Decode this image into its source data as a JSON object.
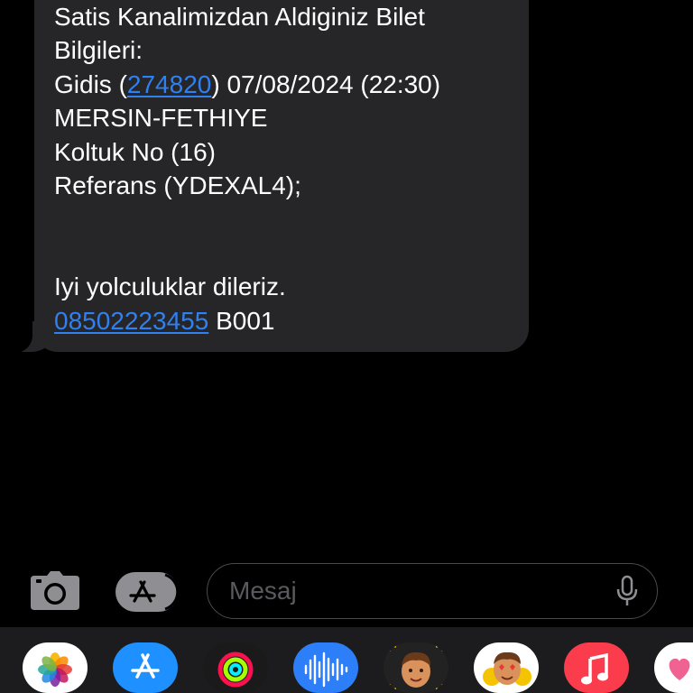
{
  "message": {
    "lines": [
      "Satis Kanalimizdan Aldiginiz Bilet",
      "Bilgileri:",
      "Gidis (",
      "274820",
      ") 07/08/2024 (22:30)",
      "MERSIN-FETHIYE",
      "Koltuk No (16)",
      "Referans (YDEXAL4);",
      "Iyi yolculuklar dileriz.",
      "08502223455",
      " B001"
    ]
  },
  "input": {
    "placeholder": "Mesaj"
  },
  "icons": {
    "camera": "camera-icon",
    "apps": "app-store-icon",
    "mic": "microphone-icon"
  },
  "colors": {
    "background": "#000000",
    "bubble": "#262628",
    "link": "#2f80f0",
    "drawer": "#1c1c1e"
  },
  "app_drawer": [
    {
      "name": "Photos",
      "icon": "photos-icon"
    },
    {
      "name": "App Store",
      "icon": "app-store-icon"
    },
    {
      "name": "Fitness",
      "icon": "activity-rings-icon"
    },
    {
      "name": "Audio Message",
      "icon": "audio-waveform-icon"
    },
    {
      "name": "Memoji",
      "icon": "memoji-icon"
    },
    {
      "name": "Memoji Stickers",
      "icon": "memoji-stickers-icon"
    },
    {
      "name": "Music",
      "icon": "music-note-icon"
    },
    {
      "name": "Digital Touch",
      "icon": "heart-touch-icon"
    }
  ]
}
